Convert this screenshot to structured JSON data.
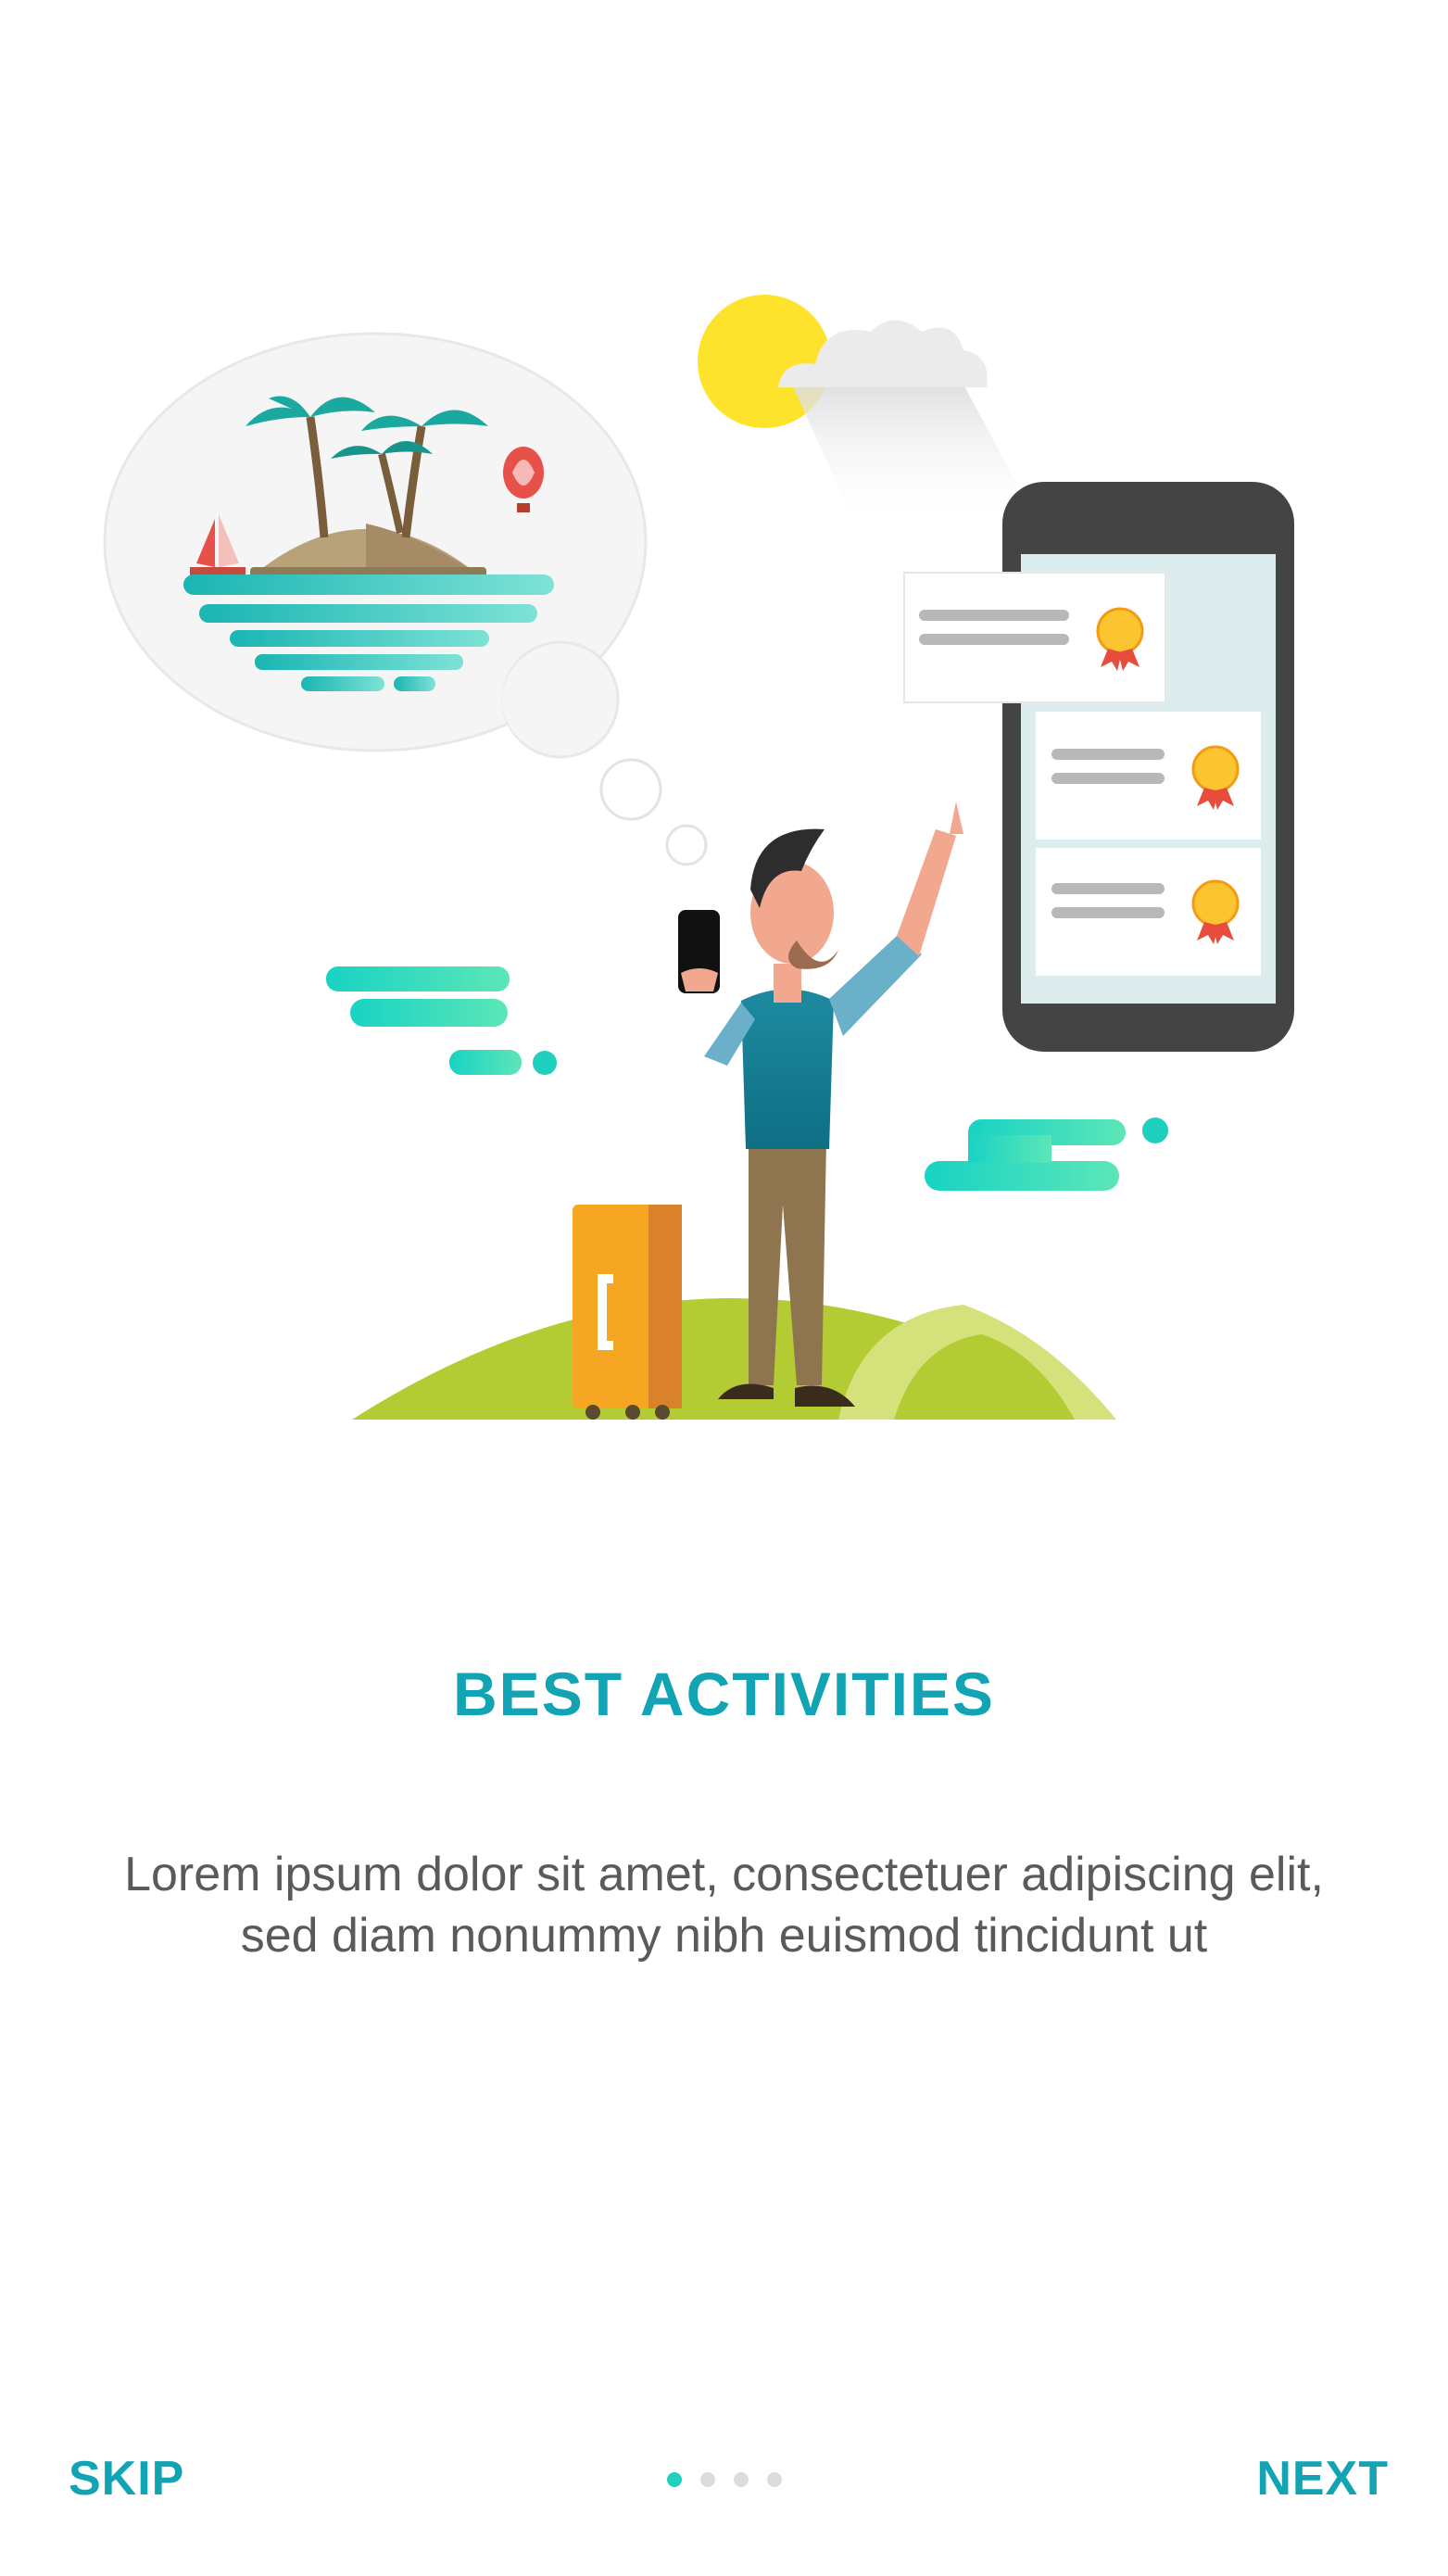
{
  "onboarding": {
    "title": "BEST ACTIVITIES",
    "description": "Lorem ipsum dolor sit amet, consectetuer adipiscing elit, sed diam nonummy nibh euismod tincidunt ut",
    "skip_label": "SKIP",
    "next_label": "NEXT",
    "pages_total": 4,
    "current_page": 1
  },
  "colors": {
    "accent": "#12a3b4",
    "dot_active": "#1ed0bd",
    "dot_inactive": "#dcdcdc",
    "body_text": "#5a5a5a"
  },
  "icons": {
    "illustration": "traveler-with-phone-illustration",
    "thought": "island-thought-bubble",
    "sun": "sun-icon",
    "cloud": "cloud-icon",
    "phone": "phone-icon",
    "award": "award-medal-icon",
    "suitcase": "suitcase-icon"
  }
}
